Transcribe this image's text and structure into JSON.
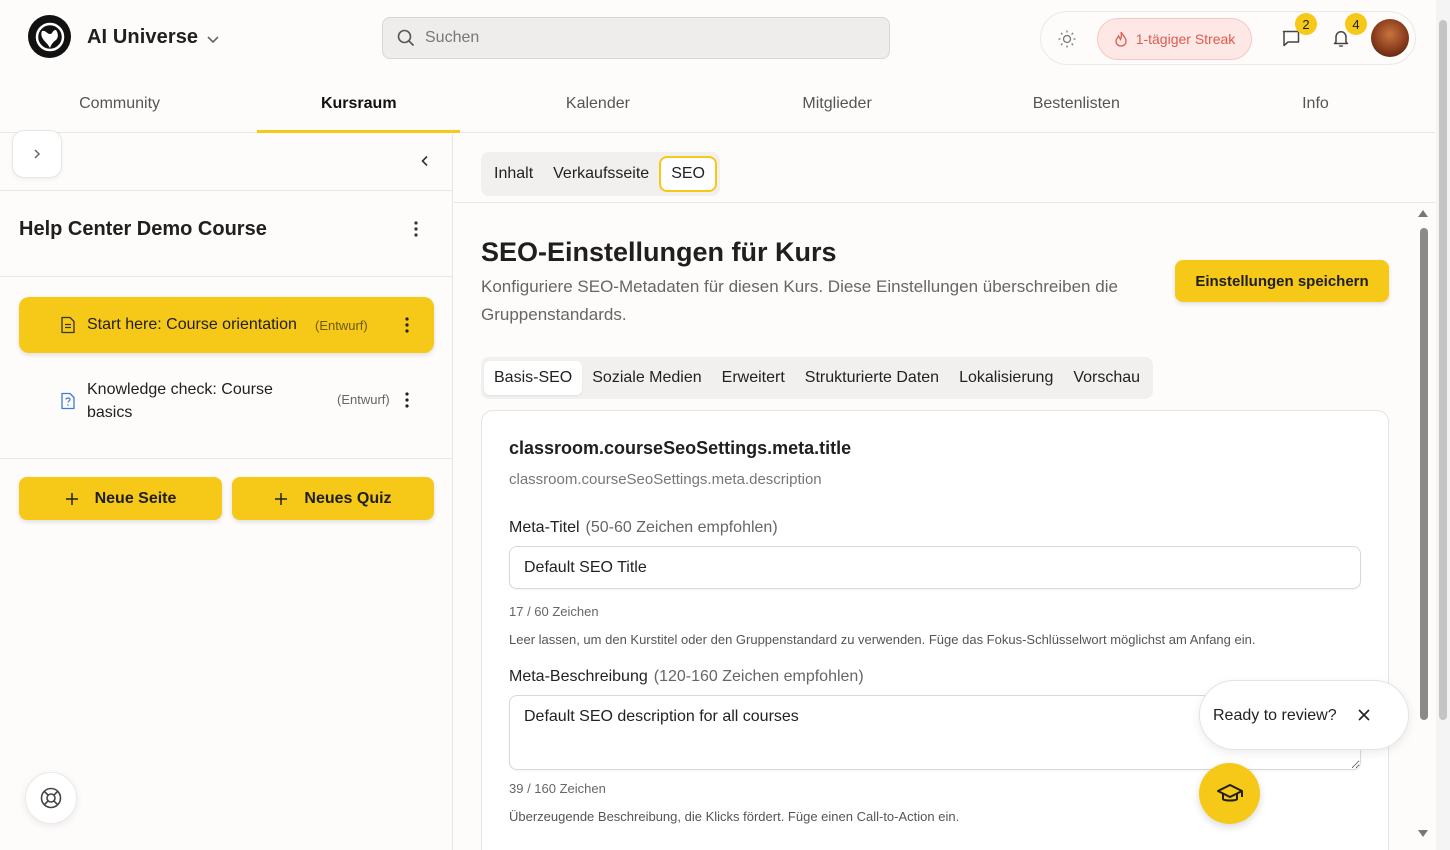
{
  "header": {
    "app_name": "AI Universe",
    "search_placeholder": "Suchen",
    "streak_label": "1-tägiger Streak",
    "messages_count": "2",
    "notifications_count": "4"
  },
  "nav": {
    "items": [
      "Community",
      "Kursraum",
      "Kalender",
      "Mitglieder",
      "Bestenlisten",
      "Info"
    ],
    "active": "Kursraum"
  },
  "sidebar": {
    "course_title": "Help Center Demo Course",
    "lessons": [
      {
        "title": "Start here: Course orientation",
        "status": "(Entwurf)"
      },
      {
        "title": "Knowledge check: Course basics",
        "status": "(Entwurf)"
      }
    ],
    "new_page_label": "Neue Seite",
    "new_quiz_label": "Neues Quiz"
  },
  "main": {
    "top_tabs": [
      "Inhalt",
      "Verkaufsseite",
      "SEO"
    ],
    "active_top_tab": "SEO",
    "title": "SEO-Einstellungen für Kurs",
    "description": "Konfiguriere SEO-Metadaten für diesen Kurs. Diese Einstellungen überschreiben die Gruppenstandards.",
    "save_label": "Einstellungen speichern",
    "sub_tabs": [
      "Basis-SEO",
      "Soziale Medien",
      "Erweitert",
      "Strukturierte Daten",
      "Lokalisierung",
      "Vorschau"
    ],
    "active_sub_tab": "Basis-SEO",
    "card": {
      "title": "classroom.courseSeoSettings.meta.title",
      "subtitle": "classroom.courseSeoSettings.meta.description",
      "meta_title_label": "Meta-Titel",
      "meta_title_hint": "(50-60 Zeichen empfohlen)",
      "meta_title_value": "Default SEO Title",
      "meta_title_counter": "17 / 60 Zeichen",
      "meta_title_help": "Leer lassen, um den Kurstitel oder den Gruppenstandard zu verwenden. Füge das Fokus-Schlüsselwort möglichst am Anfang ein.",
      "meta_desc_label": "Meta-Beschreibung",
      "meta_desc_hint": "(120-160 Zeichen empfohlen)",
      "meta_desc_value": "Default SEO description for all courses",
      "meta_desc_counter": "39 / 160 Zeichen",
      "meta_desc_help": "Überzeugende Beschreibung, die Klicks fördert. Füge einen Call-to-Action ein."
    }
  },
  "review_popup": {
    "text": "Ready to review?"
  },
  "colors": {
    "accent": "#f6c818",
    "streak_text": "#e05a4d",
    "streak_bg": "#fde8e6"
  }
}
